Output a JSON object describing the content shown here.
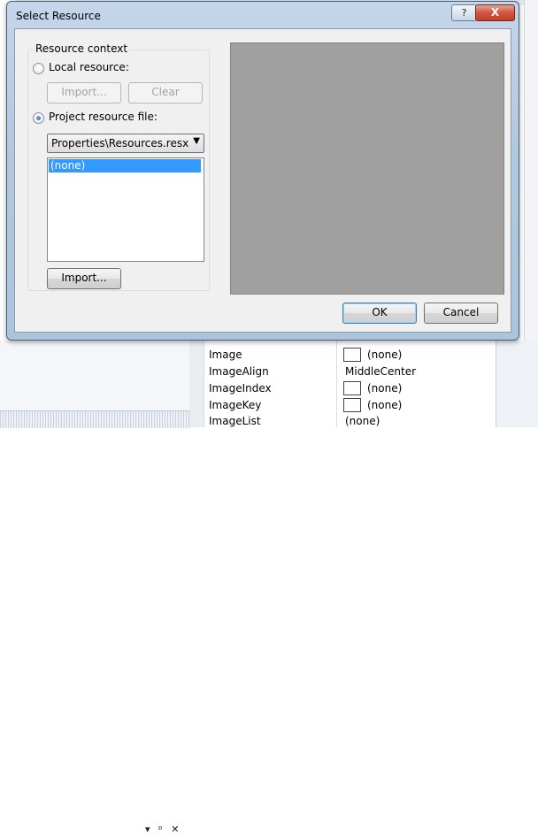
{
  "dialog": {
    "title": "Select Resource",
    "help_glyph": "?",
    "close_glyph": "X",
    "group_caption": "Resource context",
    "local_resource_label": "Local resource:",
    "local_import_label": "Import...",
    "local_clear_label": "Clear",
    "project_resource_label": "Project resource file:",
    "selected_option": "project",
    "resource_file": {
      "selected": "Properties\\Resources.resx",
      "arrow": "▼"
    },
    "resource_list": {
      "items": [
        "(none)"
      ],
      "selected_index": 0
    },
    "project_import_label": "Import...",
    "ok_label": "OK",
    "cancel_label": "Cancel"
  },
  "background": {
    "panel_buttons": [
      "▾",
      "ᵖ",
      "✕"
    ],
    "properties": [
      {
        "name": "Image",
        "value": "(none)",
        "swatch": true
      },
      {
        "name": "ImageAlign",
        "value": "MiddleCenter",
        "swatch": false
      },
      {
        "name": "ImageIndex",
        "value": "(none)",
        "swatch": true
      },
      {
        "name": "ImageKey",
        "value": "(none)",
        "swatch": true
      },
      {
        "name": "ImageList",
        "value": "(none)",
        "swatch": false
      }
    ]
  },
  "colors": {
    "selection": "#3399ff",
    "preview_bg": "#a0a0a0",
    "dialog_frame": "#b3c9e1",
    "close_button": "#c2402a"
  }
}
